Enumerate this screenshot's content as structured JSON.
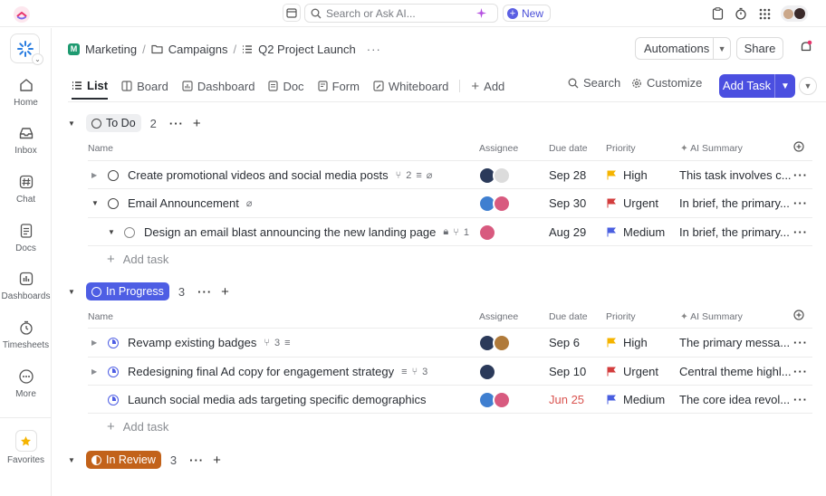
{
  "search": {
    "placeholder": "Search or Ask AI..."
  },
  "top": {
    "new_label": "New"
  },
  "sidebar": {
    "items": [
      {
        "label": "Home"
      },
      {
        "label": "Inbox"
      },
      {
        "label": "Chat"
      },
      {
        "label": "Docs"
      },
      {
        "label": "Dashboards"
      },
      {
        "label": "Timesheets"
      },
      {
        "label": "More"
      },
      {
        "label": "Favorites"
      }
    ]
  },
  "breadcrumb": {
    "space": "Marketing",
    "folder": "Campaigns",
    "list": "Q2 Project Launch",
    "space_initial": "M"
  },
  "header": {
    "automations": "Automations",
    "share": "Share"
  },
  "tabs": [
    {
      "label": "List"
    },
    {
      "label": "Board"
    },
    {
      "label": "Dashboard"
    },
    {
      "label": "Doc"
    },
    {
      "label": "Form"
    },
    {
      "label": "Whiteboard"
    },
    {
      "label": "Add"
    }
  ],
  "toolbar": {
    "search": "Search",
    "customize": "Customize",
    "add_task": "Add Task"
  },
  "columns": {
    "name": "Name",
    "assignee": "Assignee",
    "due": "Due date",
    "priority": "Priority",
    "ai": "AI Summary"
  },
  "colors": {
    "accent": "#4b4fe0",
    "in_progress": "#4e5ee4",
    "in_review": "#c2621a",
    "high": "#f5b400",
    "urgent": "#d33d3d",
    "medium": "#4a5fe0",
    "overdue": "#d9534f"
  },
  "groups": [
    {
      "status": "To Do",
      "count": "2",
      "add_task": "Add task",
      "tasks": [
        {
          "name": "Create promotional videos and social media posts",
          "subtasks": "2",
          "due": "Sep 28",
          "priority": "High",
          "ai": "This task involves c..."
        },
        {
          "name": "Email Announcement",
          "due": "Sep 30",
          "priority": "Urgent",
          "ai": "In brief, the primary..."
        },
        {
          "name": "Design an email blast announcing the new landing page",
          "subtasks": "1",
          "due": "Aug 29",
          "priority": "Medium",
          "ai": "In brief, the primary..."
        }
      ]
    },
    {
      "status": "In Progress",
      "count": "3",
      "add_task": "Add task",
      "tasks": [
        {
          "name": "Revamp existing badges",
          "subtasks": "3",
          "due": "Sep 6",
          "priority": "High",
          "ai": "The primary messa..."
        },
        {
          "name": "Redesigning final Ad copy for engagement strategy",
          "subtasks": "3",
          "due": "Sep 10",
          "priority": "Urgent",
          "ai": "Central theme highl..."
        },
        {
          "name": "Launch social media ads targeting specific demographics",
          "due": "Jun 25",
          "priority": "Medium",
          "ai": "The core idea revol..."
        }
      ]
    },
    {
      "status": "In Review",
      "count": "3"
    }
  ]
}
